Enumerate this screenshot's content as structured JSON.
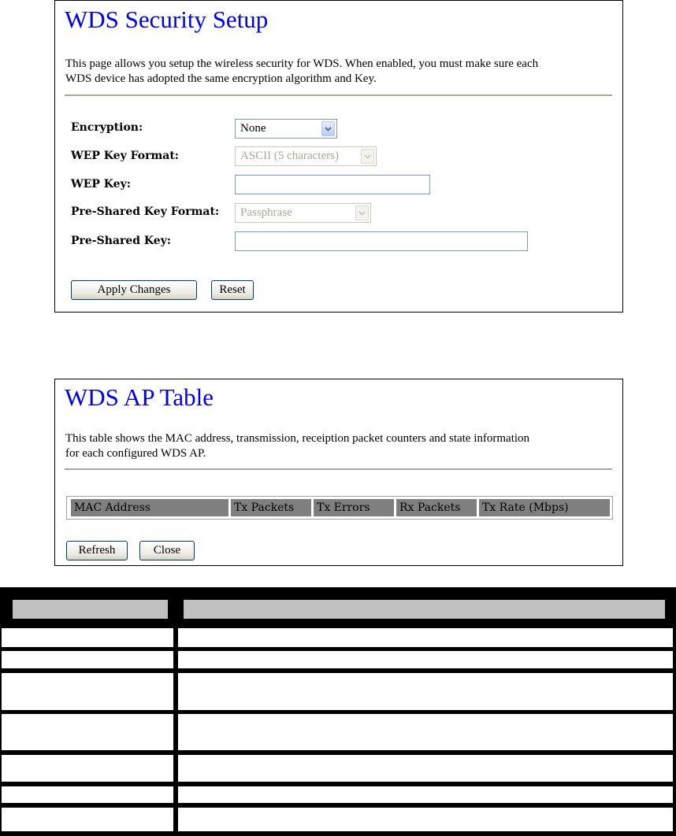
{
  "wds_security": {
    "title": "WDS Security Setup",
    "description": "This page allows you setup the wireless security for WDS. When enabled, you must make sure each WDS device has adopted the same encryption algorithm and Key.",
    "description_line1": "This page allows you setup the wireless security for WDS. When enabled, you must make sure each",
    "description_line2": "WDS device has adopted the same encryption algorithm and Key.",
    "fields": {
      "encryption": {
        "label": "Encryption:",
        "value": "None"
      },
      "wep_key_format": {
        "label": "WEP Key Format:",
        "value": "ASCII (5 characters)",
        "disabled": true
      },
      "wep_key": {
        "label": "WEP Key:",
        "value": ""
      },
      "psk_format": {
        "label": "Pre-Shared Key Format:",
        "value": "Passphrase",
        "disabled": true
      },
      "psk": {
        "label": "Pre-Shared Key:",
        "value": ""
      }
    },
    "buttons": {
      "apply": "Apply Changes",
      "reset": "Reset"
    }
  },
  "wds_ap_table": {
    "title": "WDS AP Table",
    "description_line1": "This table shows the MAC address, transmission, receiption packet counters and state information",
    "description_line2": "for each configured WDS AP.",
    "columns": [
      "MAC Address",
      "Tx Packets",
      "Tx Errors",
      "Rx Packets",
      "Tx Rate (Mbps)"
    ],
    "rows": [],
    "buttons": {
      "refresh": "Refresh",
      "close": "Close"
    }
  },
  "colors": {
    "title_blue": "#0000ee",
    "rule": "#a8a89a",
    "table_header": "#7f7f7f",
    "doc_header": "#c0c0c0"
  },
  "icons": {
    "select_arrow": "chevron-down-icon"
  }
}
